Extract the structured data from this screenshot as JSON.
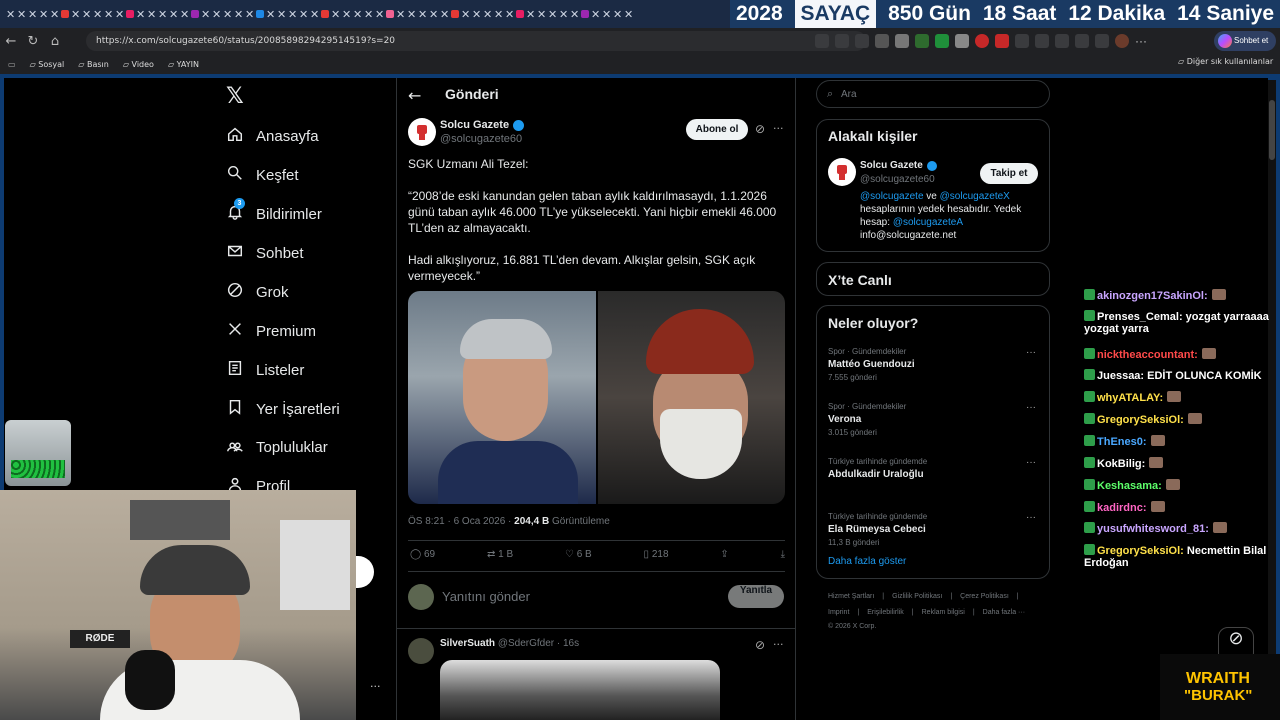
{
  "browser": {
    "url": "https://x.com/solcugazete60/status/2008589829429514519?s=20",
    "bookmarks": [
      "Sosyal",
      "Basın",
      "Video",
      "YAYIN"
    ],
    "other_bookmarks": "Diğer sık kullanılanlar",
    "chat_button": "Sohbet et"
  },
  "counter": {
    "year": "2028",
    "label": "SAYAÇ",
    "days": "850 Gün",
    "hours": "18 Saat",
    "minutes": "12 Dakika",
    "seconds": "14 Saniye"
  },
  "nav": {
    "items": [
      {
        "label": "Anasayfa",
        "icon": "home-icon"
      },
      {
        "label": "Keşfet",
        "icon": "search-icon"
      },
      {
        "label": "Bildirimler",
        "icon": "bell-icon",
        "badge": "3"
      },
      {
        "label": "Sohbet",
        "icon": "mail-icon"
      },
      {
        "label": "Grok",
        "icon": "grok-icon"
      },
      {
        "label": "Premium",
        "icon": "x-logo-icon"
      },
      {
        "label": "Listeler",
        "icon": "list-icon"
      },
      {
        "label": "Yer İşaretleri",
        "icon": "bookmark-icon"
      },
      {
        "label": "Topluluklar",
        "icon": "people-icon"
      },
      {
        "label": "Profil",
        "icon": "person-icon"
      }
    ]
  },
  "post": {
    "header": "Gönderi",
    "author": "Solcu Gazete",
    "handle": "@solcugazete60",
    "follow": "Abone ol",
    "text1": "SGK Uzmanı Ali Tezel:",
    "text2": "“2008’de eski kanundan gelen taban aylık kaldırılmasaydı, 1.1.2026 günü taban aylık 46.000 TL’ye yükselecekti. Yani hiçbir emekli 46.000 TL’den az almayacaktı.",
    "text3": "Hadi alkışlıyoruz, 16.881 TL’den devam. Alkışlar gelsin, SGK açık vermeyecek.”",
    "time": "ÖS 8:21 · 6 Oca 2026 · ",
    "views": "204,4 B",
    "views_label": " Görüntüleme",
    "replies": "69",
    "reposts": "1 B",
    "likes": "6 B",
    "bookmarks": "218",
    "reply_placeholder": "Yanıtını gönder",
    "reply_button": "Yanıtla"
  },
  "reply": {
    "author": "SilverSuath",
    "handle": "@SderGfder",
    "time": "· 16s"
  },
  "right": {
    "search_placeholder": "Ara",
    "related_title": "Alakalı kişiler",
    "related_name": "Solcu Gazete",
    "related_handle": "@solcugazete60",
    "follow_button": "Takip et",
    "bio_link1": "@solcugazete",
    "bio_and": " ve ",
    "bio_link2": "@solcugazeteX",
    "bio_text": "hesaplarının yedek hesabıdır. Yedek hesap: ",
    "bio_link3": "@solcugazeteA",
    "bio_mail": "info@solcugazete.net",
    "live_title": "X’te Canlı",
    "trends_title": "Neler oluyor?",
    "trends": [
      {
        "context": "Spor · Gündemdekiler",
        "name": "Mattéo Guendouzi",
        "count": "7.555 gönderi"
      },
      {
        "context": "Spor · Gündemdekiler",
        "name": "Verona",
        "count": "3.015 gönderi"
      },
      {
        "context": "Türkiye tarihinde gündemde",
        "name": "Abdulkadir Uraloğlu",
        "count": ""
      },
      {
        "context": "Türkiye tarihinde gündemde",
        "name": "Ela Rümeysa Cebeci",
        "count": "11,3 B gönderi"
      }
    ],
    "show_more": "Daha fazla göster",
    "footer1": [
      "Hizmet Şartları",
      "Gizlilik Politikası",
      "Çerez Politikası"
    ],
    "footer2": [
      "Imprint",
      "Erişilebilirlik",
      "Reklam bilgisi",
      "Daha fazla ···"
    ],
    "copyright": "© 2026 X Corp."
  },
  "chat": [
    {
      "user": "akinozgen17SakinOl:",
      "msg": "",
      "color": "#c9a6ff"
    },
    {
      "user": "Prenses_Cemal:",
      "msg": "yozgat yarraaaa yozgat yarra",
      "color": "#ffffff"
    },
    {
      "user": "nicktheaccountant:",
      "msg": "",
      "color": "#ff4a4a"
    },
    {
      "user": "Juessaa:",
      "msg": "EDİT OLUNCA KOMİK",
      "color": "#ffffff"
    },
    {
      "user": "whyATALAY:",
      "msg": "",
      "color": "#ffe14a"
    },
    {
      "user": "GregorySeksiOl:",
      "msg": "",
      "color": "#ffe14a"
    },
    {
      "user": "ThEnes0:",
      "msg": "",
      "color": "#4aa8ff"
    },
    {
      "user": "KokBilig:",
      "msg": "",
      "color": "#ffffff"
    },
    {
      "user": "Keshasama:",
      "msg": "",
      "color": "#5dff6a"
    },
    {
      "user": "kadirdnc:",
      "msg": "",
      "color": "#ff66c4"
    },
    {
      "user": "yusufwhitesword_81:",
      "msg": "",
      "color": "#c9a6ff"
    },
    {
      "user": "GregorySeksiOl:",
      "msg": "Necmettin Bilal Erdoğan",
      "color": "#ffe14a"
    }
  ],
  "overlay": {
    "brand_top": "WRAITH",
    "brand_bottom": "\"BURAK\"",
    "mic_brand": "RØDE"
  }
}
